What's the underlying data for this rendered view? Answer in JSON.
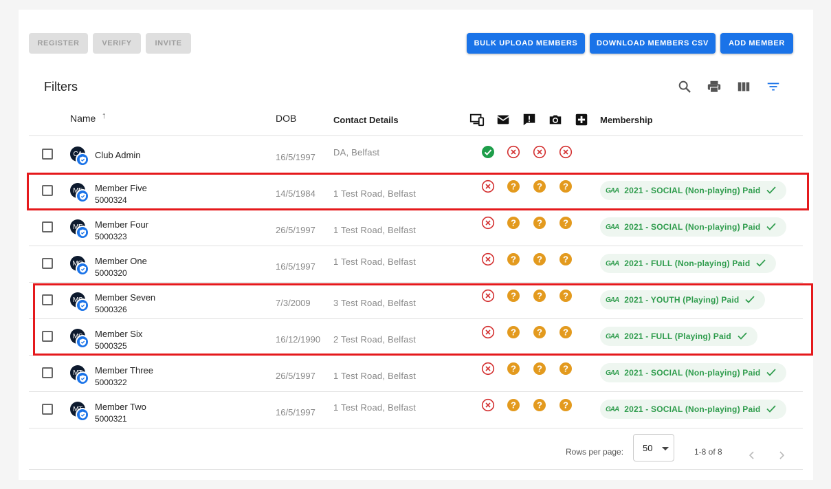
{
  "toolbar": {
    "register": "REGISTER",
    "verify": "VERIFY",
    "invite": "INVITE",
    "bulk_upload": "BULK UPLOAD MEMBERS",
    "download_csv": "DOWNLOAD MEMBERS CSV",
    "add_member": "ADD MEMBER"
  },
  "table": {
    "title": "Filters",
    "headers": {
      "name": "Name",
      "sort_arrow": "↑",
      "dob": "DOB",
      "contact": "Contact Details",
      "membership": "Membership"
    },
    "status_icons": [
      "app-access-icon",
      "email-icon",
      "alert-icon",
      "camera-icon",
      "medical-icon"
    ],
    "rows": [
      {
        "initials": "CA",
        "name": "Club Admin",
        "id": "",
        "dob": "16/5/1997",
        "address": "DA, Belfast",
        "status": [
          "ok",
          "x",
          "x",
          "x"
        ],
        "membership": ""
      },
      {
        "initials": "MF",
        "name": "Member Five",
        "id": "5000324",
        "dob": "14/5/1984",
        "address": "1 Test Road, Belfast",
        "status": [
          "x",
          "q",
          "q",
          "q"
        ],
        "membership": "2021 - SOCIAL (Non-playing) Paid"
      },
      {
        "initials": "MF",
        "name": "Member Four",
        "id": "5000323",
        "dob": "26/5/1997",
        "address": "1 Test Road, Belfast",
        "status": [
          "x",
          "q",
          "q",
          "q"
        ],
        "membership": "2021 - SOCIAL (Non-playing) Paid"
      },
      {
        "initials": "MO",
        "name": "Member One",
        "id": "5000320",
        "dob": "16/5/1997",
        "address": "1 Test Road, Belfast",
        "status": [
          "x",
          "q",
          "q",
          "q"
        ],
        "membership": "2021 - FULL (Non-playing) Paid"
      },
      {
        "initials": "MS",
        "name": "Member Seven",
        "id": "5000326",
        "dob": "7/3/2009",
        "address": "3 Test Road, Belfast",
        "status": [
          "x",
          "q",
          "q",
          "q"
        ],
        "membership": "2021 - YOUTH (Playing) Paid"
      },
      {
        "initials": "MS",
        "name": "Member Six",
        "id": "5000325",
        "dob": "16/12/1990",
        "address": "2 Test Road, Belfast",
        "status": [
          "x",
          "q",
          "q",
          "q"
        ],
        "membership": "2021 - FULL (Playing) Paid"
      },
      {
        "initials": "MT",
        "name": "Member Three",
        "id": "5000322",
        "dob": "26/5/1997",
        "address": "1 Test Road, Belfast",
        "status": [
          "x",
          "q",
          "q",
          "q"
        ],
        "membership": "2021 - SOCIAL (Non-playing) Paid"
      },
      {
        "initials": "MT",
        "name": "Member Two",
        "id": "5000321",
        "dob": "16/5/1997",
        "address": "1 Test Road, Belfast",
        "status": [
          "x",
          "q",
          "q",
          "q"
        ],
        "membership": "2021 - SOCIAL (Non-playing) Paid"
      }
    ],
    "chip_logo": "GAA"
  },
  "pagination": {
    "rows_per_page_label": "Rows per page:",
    "rows_per_page": "50",
    "range": "1-8 of 8"
  },
  "colors": {
    "primary": "#1a73e8",
    "ok": "#1e9e4a",
    "error": "#d32f2f",
    "warning": "#e39a1e",
    "chip_text": "#2e9c4c",
    "highlight": "#e5191c"
  }
}
